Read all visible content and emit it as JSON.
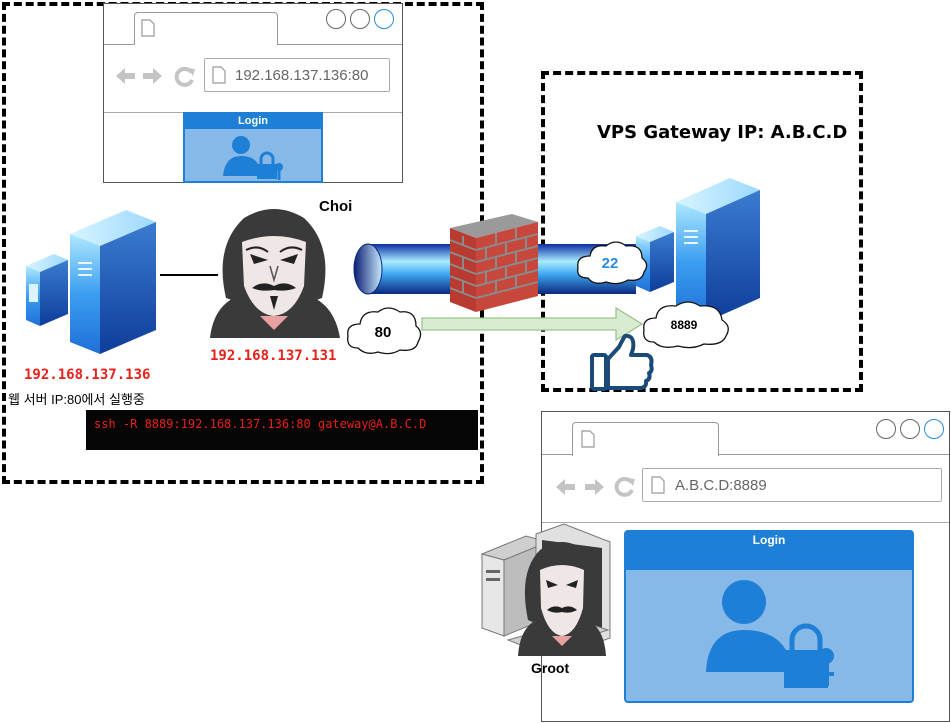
{
  "browser_top": {
    "address": "192.168.137.136:80",
    "login_title": "Login"
  },
  "browser_bottom": {
    "address": "A.B.C.D:8889",
    "login_title": "Login"
  },
  "labels": {
    "vps_gateway": "VPS Gateway IP: A.B.C.D",
    "choi": "Choi",
    "choi_ip": "192.168.137.131",
    "server_ip": "192.168.137.136",
    "server_desc": "웹 서버 IP:80에서 실행중",
    "groot": "Groot"
  },
  "ports": {
    "ssh": "22",
    "local": "80",
    "remote": "8889"
  },
  "terminal": {
    "command": "ssh -R 8889:192.168.137.136:80 gateway@A.B.C.D"
  },
  "colors": {
    "login_blue": "#1e7fd6",
    "login_fill": "#86b9e8",
    "alert_red": "#e8201a",
    "server_blue": "#2a8be0"
  }
}
